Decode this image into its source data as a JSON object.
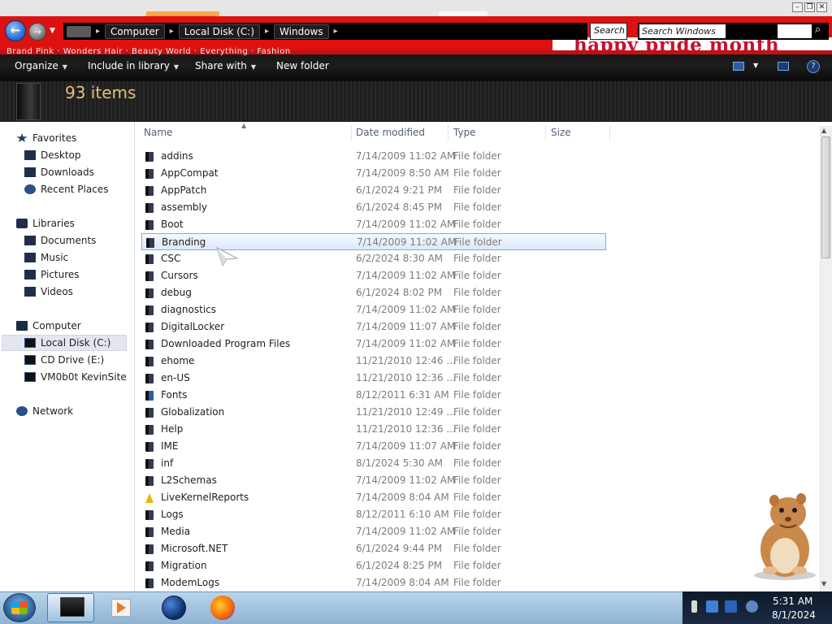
{
  "window": {
    "banner_text": "happy pride month",
    "stripe_text": "Brand Pink · Wonders Hair · Beauty World · Everything · Fashion"
  },
  "address": {
    "crumbs": [
      "Computer",
      "Local Disk (C:)",
      "Windows"
    ]
  },
  "search": {
    "stub_text": "Search C",
    "placeholder": "Search Windows"
  },
  "toolbar": {
    "organize": "Organize",
    "include_in_library": "Include in library",
    "share_with": "Share with",
    "new_folder": "New folder"
  },
  "details": {
    "item_count": "93 items"
  },
  "nav": {
    "favorites": "Favorites",
    "desktop": "Desktop",
    "downloads": "Downloads",
    "recent_places": "Recent Places",
    "libraries": "Libraries",
    "documents": "Documents",
    "music": "Music",
    "pictures": "Pictures",
    "videos": "Videos",
    "computer": "Computer",
    "local_disk": "Local Disk (C:)",
    "cd_drive": "CD Drive (E:)",
    "vm_share": "VM0b0t KevinSite",
    "network": "Network"
  },
  "columns": {
    "name": "Name",
    "date_modified": "Date modified",
    "type": "Type",
    "size": "Size"
  },
  "files": [
    {
      "name": "addins",
      "date": "7/14/2009 11:02 AM",
      "type": "File folder"
    },
    {
      "name": "AppCompat",
      "date": "7/14/2009 8:50 AM",
      "type": "File folder"
    },
    {
      "name": "AppPatch",
      "date": "6/1/2024 9:21 PM",
      "type": "File folder"
    },
    {
      "name": "assembly",
      "date": "6/1/2024 8:45 PM",
      "type": "File folder"
    },
    {
      "name": "Boot",
      "date": "7/14/2009 11:02 AM",
      "type": "File folder"
    },
    {
      "name": "Branding",
      "date": "7/14/2009 11:02 AM",
      "type": "File folder"
    },
    {
      "name": "CSC",
      "date": "6/2/2024 8:30 AM",
      "type": "File folder"
    },
    {
      "name": "Cursors",
      "date": "7/14/2009 11:02 AM",
      "type": "File folder"
    },
    {
      "name": "debug",
      "date": "6/1/2024 8:02 PM",
      "type": "File folder"
    },
    {
      "name": "diagnostics",
      "date": "7/14/2009 11:02 AM",
      "type": "File folder"
    },
    {
      "name": "DigitalLocker",
      "date": "7/14/2009 11:07 AM",
      "type": "File folder"
    },
    {
      "name": "Downloaded Program Files",
      "date": "7/14/2009 11:02 AM",
      "type": "File folder"
    },
    {
      "name": "ehome",
      "date": "11/21/2010 12:46 ...",
      "type": "File folder"
    },
    {
      "name": "en-US",
      "date": "11/21/2010 12:36 ...",
      "type": "File folder"
    },
    {
      "name": "Fonts",
      "date": "8/12/2011 6:31 AM",
      "type": "File folder"
    },
    {
      "name": "Globalization",
      "date": "11/21/2010 12:49 ...",
      "type": "File folder"
    },
    {
      "name": "Help",
      "date": "11/21/2010 12:36 ...",
      "type": "File folder"
    },
    {
      "name": "IME",
      "date": "7/14/2009 11:07 AM",
      "type": "File folder"
    },
    {
      "name": "inf",
      "date": "8/1/2024 5:30 AM",
      "type": "File folder"
    },
    {
      "name": "L2Schemas",
      "date": "7/14/2009 11:02 AM",
      "type": "File folder"
    },
    {
      "name": "LiveKernelReports",
      "date": "7/14/2009 8:04 AM",
      "type": "File folder"
    },
    {
      "name": "Logs",
      "date": "8/12/2011 6:10 AM",
      "type": "File folder"
    },
    {
      "name": "Media",
      "date": "7/14/2009 11:02 AM",
      "type": "File folder"
    },
    {
      "name": "Microsoft.NET",
      "date": "6/1/2024 9:44 PM",
      "type": "File folder"
    },
    {
      "name": "Migration",
      "date": "6/1/2024 8:25 PM",
      "type": "File folder"
    },
    {
      "name": "ModemLogs",
      "date": "7/14/2009 8:04 AM",
      "type": "File folder"
    }
  ],
  "clock": {
    "time": "5:31 AM",
    "date": "8/1/2024"
  },
  "colors": {
    "accent_red": "#dd1111",
    "toolbar_black": "#141414",
    "item_count_gold": "#e5c079",
    "selection_border": "#84acdd"
  }
}
